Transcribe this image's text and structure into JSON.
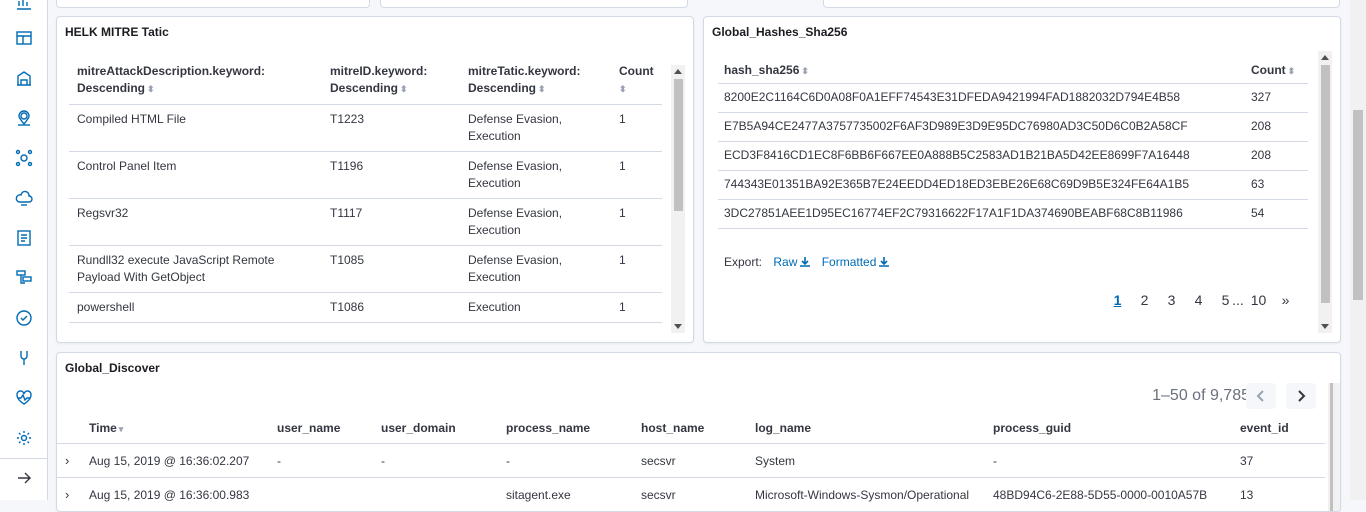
{
  "mitre_panel": {
    "title": "HELK MITRE Tatic",
    "columns": [
      {
        "line1": "mitreAttackDescription.keyword:",
        "line2": "Descending"
      },
      {
        "line1": "mitreID.keyword:",
        "line2": "Descending"
      },
      {
        "line1": "mitreTatic.keyword:",
        "line2": "Descending"
      },
      {
        "line1": "Count",
        "line2": ""
      }
    ],
    "rows": [
      {
        "desc": "Compiled HTML File",
        "id": "T1223",
        "tactic": "Defense Evasion, Execution",
        "count": "1"
      },
      {
        "desc": "Control Panel Item",
        "id": "T1196",
        "tactic": "Defense Evasion, Execution",
        "count": "1"
      },
      {
        "desc": "Regsvr32",
        "id": "T1117",
        "tactic": "Defense Evasion, Execution",
        "count": "1"
      },
      {
        "desc": "Rundll32 execute JavaScript Remote Payload With GetObject",
        "id": "T1085",
        "tactic": "Defense Evasion, Execution",
        "count": "1"
      },
      {
        "desc": "powershell",
        "id": "T1086",
        "tactic": "Execution",
        "count": "1"
      }
    ]
  },
  "hash_panel": {
    "title": "Global_Hashes_Sha256",
    "columns": {
      "hash": "hash_sha256",
      "count": "Count"
    },
    "rows": [
      {
        "hash": "8200E2C1164C6D0A08F0A1EFF74543E31DFEDA9421994FAD1882032D794E4B58",
        "count": "327"
      },
      {
        "hash": "E7B5A94CE2477A3757735002F6AF3D989E3D9E95DC76980AD3C50D6C0B2A58CF",
        "count": "208"
      },
      {
        "hash": "ECD3F8416CD1EC8F6BB6F667EE0A888B5C2583AD1B21BA5D42EE8699F7A16448",
        "count": "208"
      },
      {
        "hash": "744343E01351BA92E365B7E24EEDD4ED18ED3EBE26E68C69D9B5E324FE64A1B5",
        "count": "63"
      },
      {
        "hash": "3DC27851AEE1D95EC16774EF2C79316622F17A1F1DA374690BEABF68C8B11986",
        "count": "54"
      }
    ],
    "export_label": "Export:",
    "export_raw": "Raw",
    "export_formatted": "Formatted",
    "pages": [
      "1",
      "2",
      "3",
      "4",
      "5",
      "...",
      "10",
      "»"
    ],
    "active_page": "1"
  },
  "discover_panel": {
    "title": "Global_Discover",
    "count_label": "1–50 of 9,785",
    "columns": [
      "Time",
      "user_name",
      "user_domain",
      "process_name",
      "host_name",
      "log_name",
      "process_guid",
      "event_id"
    ],
    "rows": [
      {
        "time": "Aug 15, 2019 @ 16:36:02.207",
        "user_name": "-",
        "user_domain": "-",
        "process_name": "-",
        "host_name": "secsvr",
        "log_name": "System",
        "process_guid": "-",
        "event_id": "37"
      },
      {
        "time": "Aug 15, 2019 @ 16:36:00.983",
        "user_name": "",
        "user_domain": "",
        "process_name": "sitagent.exe",
        "host_name": "secsvr",
        "log_name": "Microsoft-Windows-Sysmon/Operational",
        "process_guid": "48BD94C6-2E88-5D55-0000-0010A57B",
        "event_id": "13"
      }
    ]
  }
}
